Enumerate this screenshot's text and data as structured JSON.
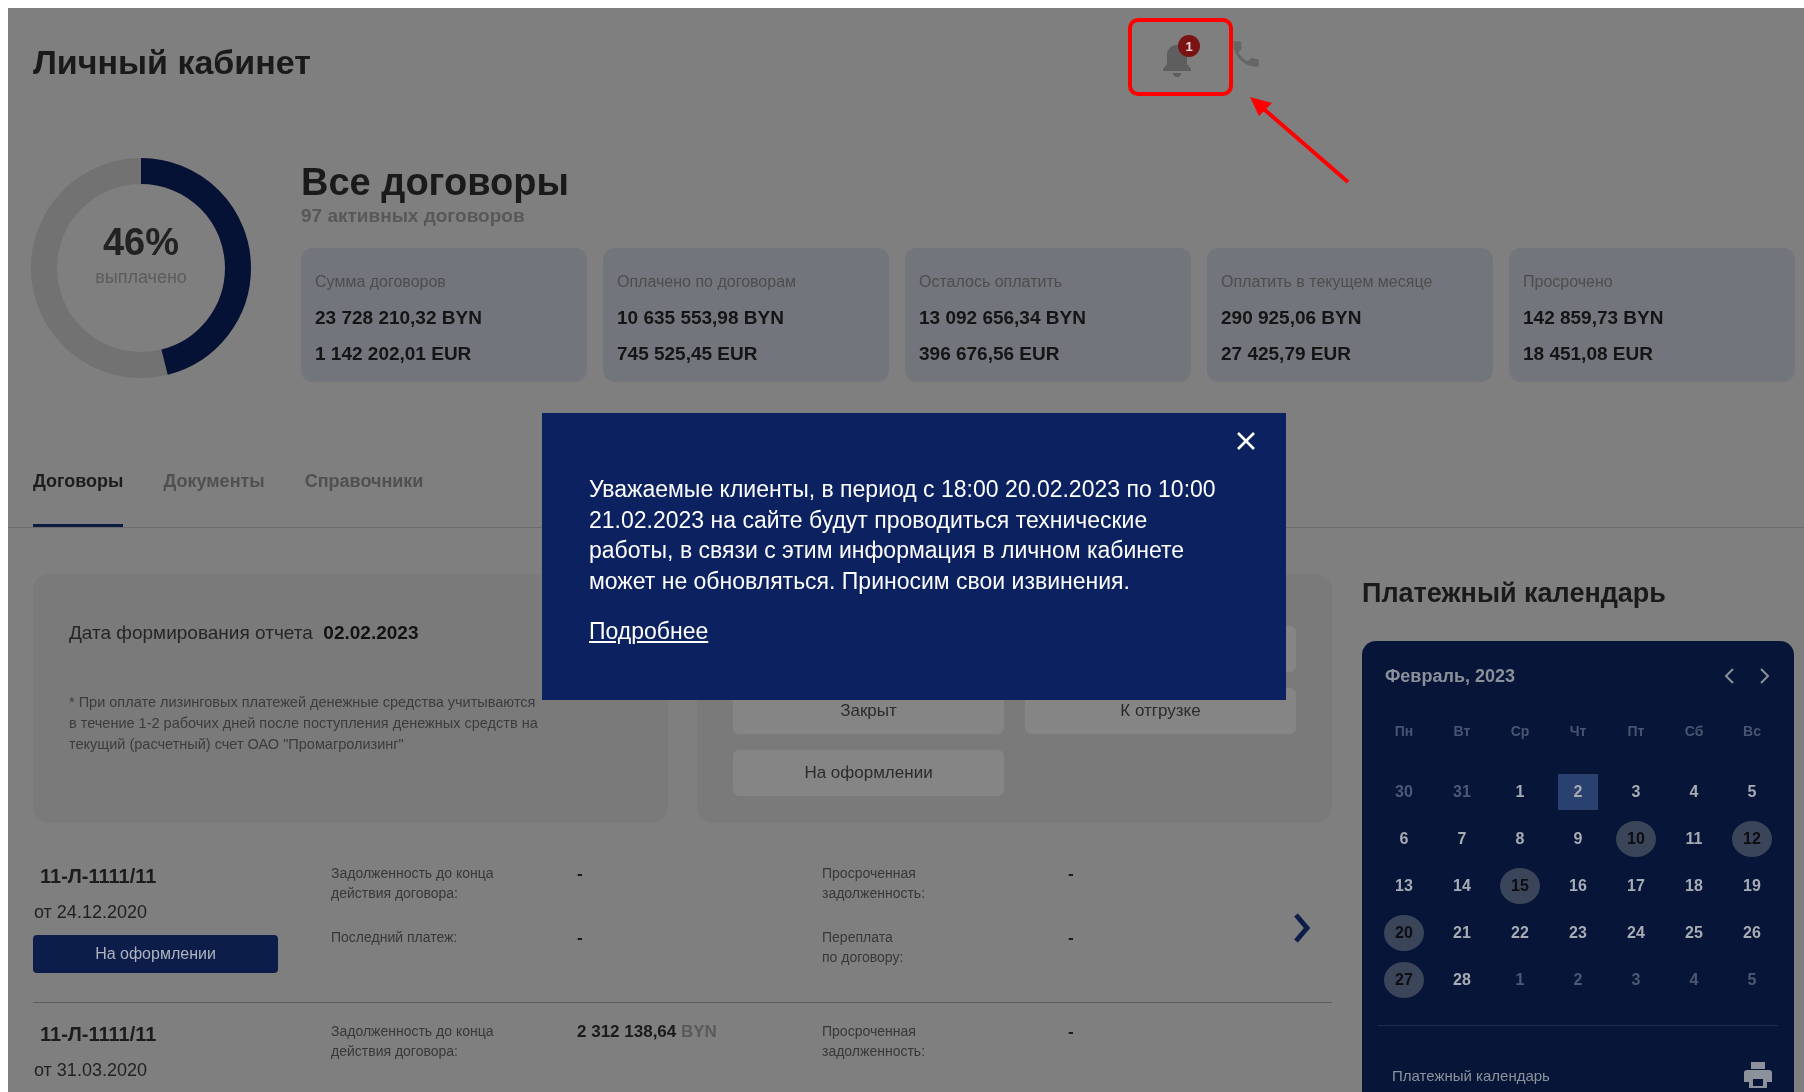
{
  "header": {
    "title": "Личный кабинет",
    "notifications": {
      "count": "1"
    }
  },
  "summary": {
    "gauge": {
      "percent": "46%",
      "caption": "выплачено",
      "level": 0.46
    },
    "title": "Все договоры",
    "subtitle": "97 активных договоров",
    "cards": [
      {
        "label": "Сумма договоров",
        "byn": "23 728 210,32 BYN",
        "eur": "1 142 202,01 EUR"
      },
      {
        "label": "Оплачено по договорам",
        "byn": "10 635 553,98 BYN",
        "eur": "745 525,45 EUR"
      },
      {
        "label": "Осталось оплатить",
        "byn": "13 092 656,34 BYN",
        "eur": "396 676,56 EUR"
      },
      {
        "label": "Оплатить в текущем месяце",
        "byn": "290 925,06 BYN",
        "eur": "27 425,79 EUR"
      },
      {
        "label": "Просрочено",
        "byn": "142 859,73 BYN",
        "eur": "18 451,08 EUR"
      }
    ]
  },
  "tabs": [
    {
      "label": "Договоры",
      "selected": true
    },
    {
      "label": "Документы",
      "selected": false
    },
    {
      "label": "Справочники",
      "selected": false
    }
  ],
  "report": {
    "date_label": "Дата формирования отчета",
    "date": "02.02.2023",
    "note": "* При оплате лизинговых платежей денежные средства учитываются в течение 1-2 рабочих дней после поступления денежных средств на текущий (расчетный) счет ОАО \"Промагролизинг\""
  },
  "status_filters": [
    "Закрыт",
    "К отгрузке",
    "На оформлении"
  ],
  "contracts": [
    {
      "number": "11-Л-1111/11",
      "date": "от 24.12.2020",
      "status": "На оформлении",
      "fields": [
        {
          "label": "Задолженность до конца\nдействия договора:",
          "value": "-"
        },
        {
          "label": "Последний платеж:",
          "value": "-"
        },
        {
          "label": "Просроченная\nзадолженность:",
          "value": "-"
        },
        {
          "label": "Переплата\nпо договору:",
          "value": "-"
        }
      ]
    },
    {
      "number": "11-Л-1111/11",
      "date": "от 31.03.2020",
      "fields": [
        {
          "label": "Задолженность до конца\nдействия договора:",
          "value": "2 312 138,64",
          "currency": "BYN"
        },
        {
          "label": "Просроченная\nзадолженность:",
          "value": "-"
        }
      ]
    }
  ],
  "calendar": {
    "title": "Платежный календарь",
    "month": "Февраль, 2023",
    "weekdays": [
      "Пн",
      "Вт",
      "Ср",
      "Чт",
      "Пт",
      "Сб",
      "Вс"
    ],
    "days": [
      {
        "day": "30",
        "kind": "outside"
      },
      {
        "day": "31",
        "kind": "outside"
      },
      {
        "day": "1",
        "kind": "day"
      },
      {
        "day": "2",
        "kind": "today"
      },
      {
        "day": "3",
        "kind": "day"
      },
      {
        "day": "4",
        "kind": "day"
      },
      {
        "day": "5",
        "kind": "day"
      },
      {
        "day": "6",
        "kind": "day"
      },
      {
        "day": "7",
        "kind": "day"
      },
      {
        "day": "8",
        "kind": "day"
      },
      {
        "day": "9",
        "kind": "day"
      },
      {
        "day": "10",
        "kind": "payment"
      },
      {
        "day": "11",
        "kind": "day"
      },
      {
        "day": "12",
        "kind": "payment"
      },
      {
        "day": "13",
        "kind": "day"
      },
      {
        "day": "14",
        "kind": "day"
      },
      {
        "day": "15",
        "kind": "payment"
      },
      {
        "day": "16",
        "kind": "day"
      },
      {
        "day": "17",
        "kind": "day"
      },
      {
        "day": "18",
        "kind": "day"
      },
      {
        "day": "19",
        "kind": "day"
      },
      {
        "day": "20",
        "kind": "payment"
      },
      {
        "day": "21",
        "kind": "day"
      },
      {
        "day": "22",
        "kind": "day"
      },
      {
        "day": "23",
        "kind": "day"
      },
      {
        "day": "24",
        "kind": "day"
      },
      {
        "day": "25",
        "kind": "day"
      },
      {
        "day": "26",
        "kind": "day"
      },
      {
        "day": "27",
        "kind": "payment"
      },
      {
        "day": "28",
        "kind": "day"
      },
      {
        "day": "1",
        "kind": "outside"
      },
      {
        "day": "2",
        "kind": "outside"
      },
      {
        "day": "3",
        "kind": "outside"
      },
      {
        "day": "4",
        "kind": "outside"
      },
      {
        "day": "5",
        "kind": "outside"
      }
    ],
    "footer": "Платежный календарь"
  },
  "modal": {
    "message": "Уважаемые клиенты, в период с 18:00 20.02.2023 по 10:00 21.02.2023 на сайте будут проводиться технические работы, в связи с этим информация в личном кабинете может не обновляться. Приносим свои извинения.",
    "link": "Подробнее"
  }
}
